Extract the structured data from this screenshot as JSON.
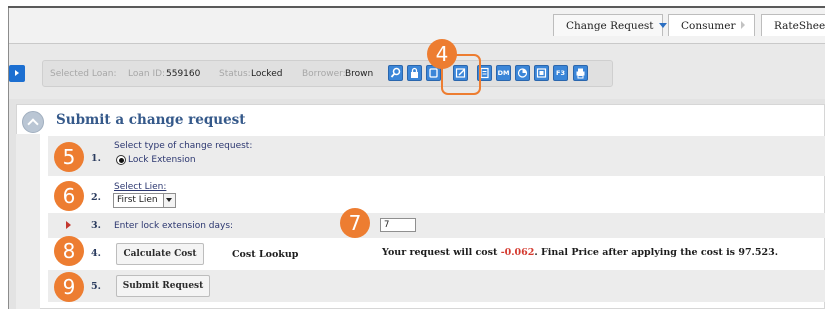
{
  "tabs": [
    {
      "label": "Change Request",
      "active": true
    },
    {
      "label": "Consumer"
    },
    {
      "label": "RateSheet"
    }
  ],
  "loan_bar": {
    "selected_loan_label": "Selected Loan:",
    "loan_id_label": "Loan ID:",
    "loan_id": "559160",
    "status_label": "Status:",
    "status": "Locked",
    "borrower_label": "Borrower:",
    "borrower": "Brown",
    "toolbar_icons": [
      "search-icon",
      "lock-icon",
      "tool-icon",
      "edit-icon",
      "note-icon",
      "calendar-icon",
      "chart-icon",
      "document-icon",
      "form-icon",
      "print-icon"
    ],
    "icon_text": {
      "calendar": "DM",
      "form": "F3"
    }
  },
  "panel": {
    "title": "Submit a change request",
    "steps": [
      {
        "number": "1.",
        "label": "Select type of change request:",
        "option": "Lock Extension",
        "selected": true
      },
      {
        "number": "2.",
        "label": "Select Lien:",
        "value": "First Lien"
      },
      {
        "number": "3.",
        "label": "Enter lock extension days:",
        "value": "7"
      },
      {
        "number": "4.",
        "button": "Calculate Cost",
        "link": "Cost Lookup",
        "result_prefix": "Your request will cost",
        "cost": "-0.062",
        "result_suffix": ". Final Price after applying the cost is 97.523."
      },
      {
        "number": "5.",
        "button": "Submit Request"
      }
    ]
  },
  "callouts": [
    "4",
    "5",
    "6",
    "7",
    "8",
    "9"
  ],
  "colors": {
    "accent": "#ed7d31",
    "brand_blue": "#1c6fd1",
    "title": "#35598a",
    "negative": "#d43a2f"
  }
}
